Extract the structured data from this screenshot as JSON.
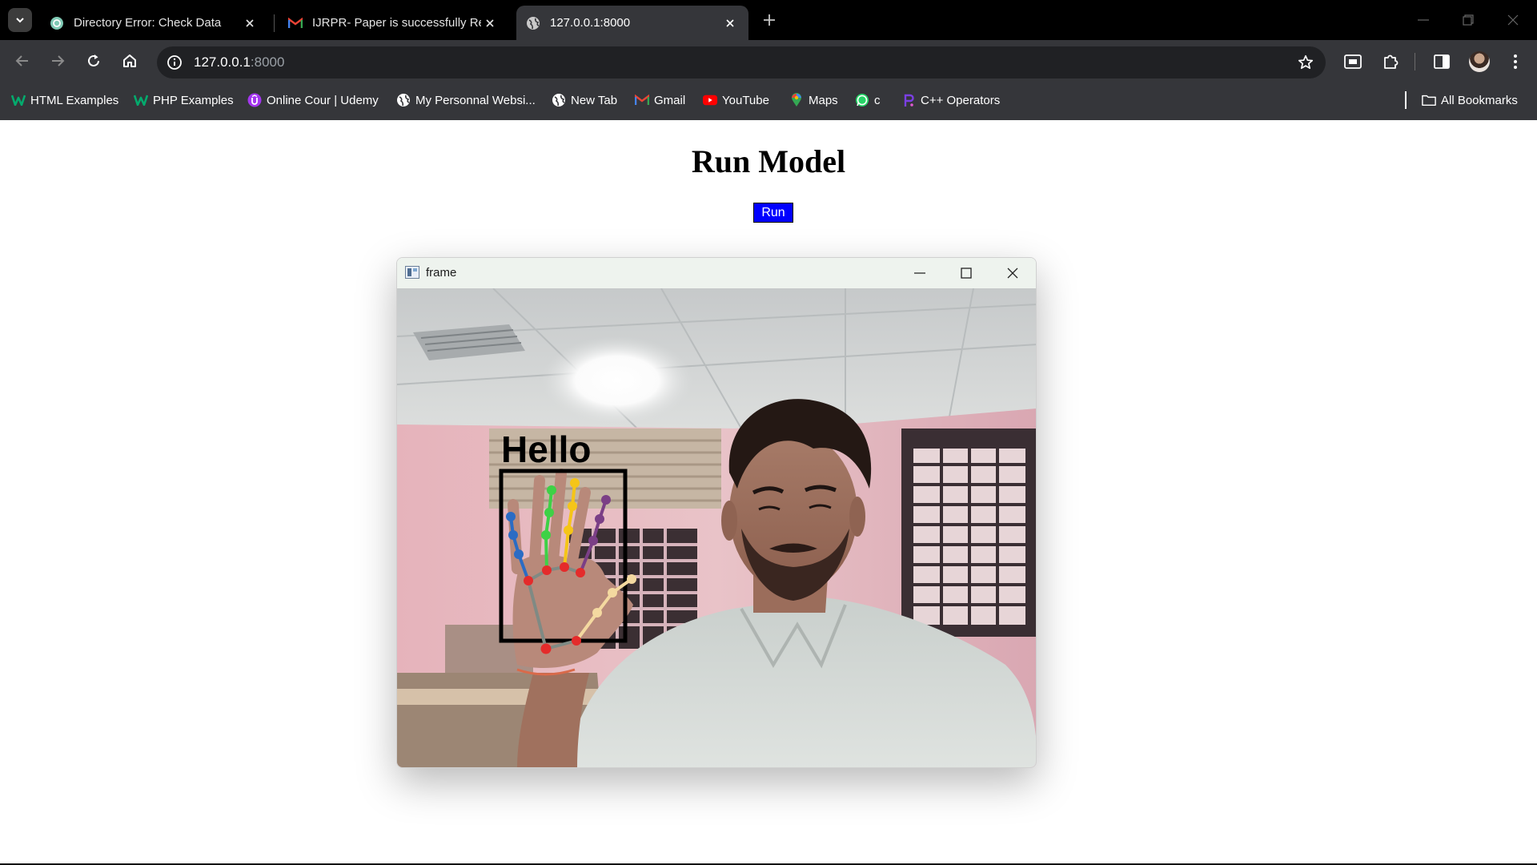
{
  "browser": {
    "tabs": [
      {
        "title": "Directory Error: Check Data",
        "favicon": "chatgpt-icon",
        "active": false
      },
      {
        "title": "IJRPR- Paper is successfully Rec",
        "favicon": "gmail-icon",
        "active": false
      },
      {
        "title": "127.0.0.1:8000",
        "favicon": "globe-icon",
        "active": true
      }
    ],
    "address": {
      "host": "127.0.0.1",
      "port": ":8000"
    },
    "bookmarks": [
      {
        "label": "HTML Examples",
        "icon": "w3schools-icon",
        "color": "#04aa6d"
      },
      {
        "label": "PHP Examples",
        "icon": "w3schools-icon",
        "color": "#04aa6d"
      },
      {
        "label": "Online Cour | Udemy",
        "icon": "udemy-icon",
        "color": "#a435f0"
      },
      {
        "label": "My Personnal Websi...",
        "icon": "globe-icon",
        "color": "#ffffff"
      },
      {
        "label": "New Tab",
        "icon": "globe-icon",
        "color": "#ffffff"
      },
      {
        "label": "Gmail",
        "icon": "gmail-icon",
        "color": "#ea4335"
      },
      {
        "label": "YouTube",
        "icon": "youtube-icon",
        "color": "#ff0000"
      },
      {
        "label": "Maps",
        "icon": "maps-icon",
        "color": "#34a853"
      },
      {
        "label": "c",
        "icon": "whatsapp-icon",
        "color": "#25d366"
      },
      {
        "label": "C++ Operators",
        "icon": "cplusplus-icon",
        "color": "#7b3fe4"
      }
    ],
    "all_bookmarks_label": "All Bookmarks"
  },
  "page": {
    "title": "Run Model",
    "run_button_label": "Run"
  },
  "cv_window": {
    "title": "frame",
    "overlay_text": "Hello"
  }
}
